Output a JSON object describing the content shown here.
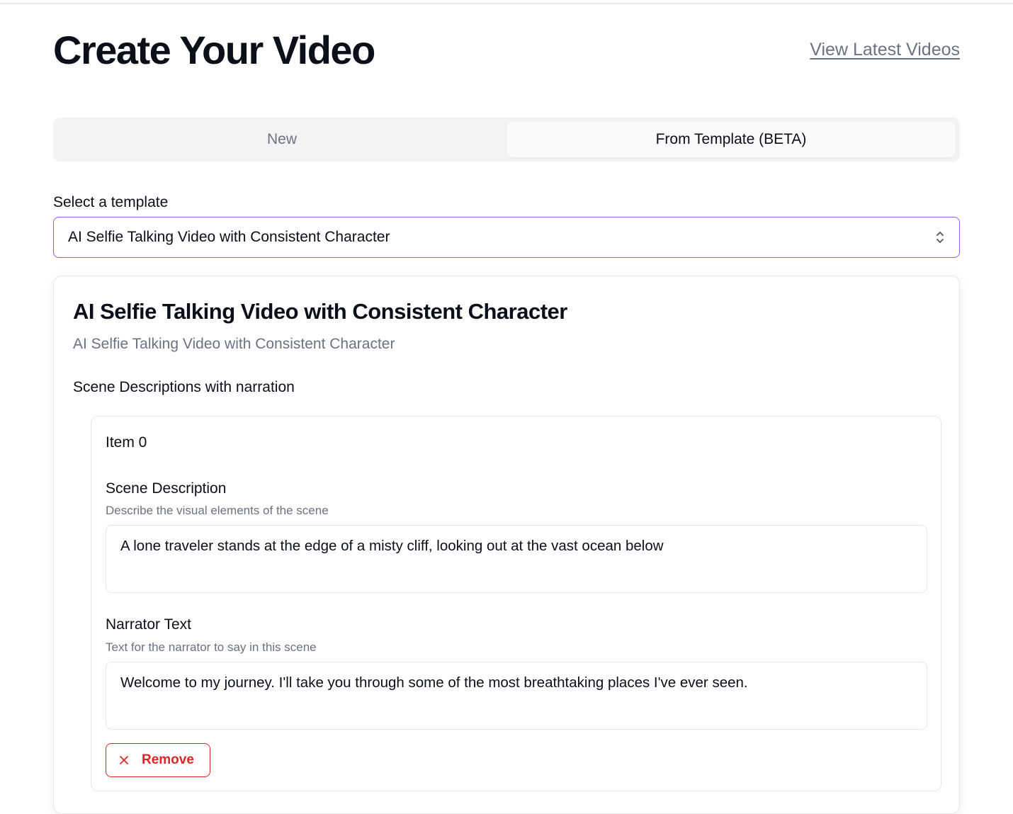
{
  "header": {
    "title": "Create Your Video",
    "latest_link": "View Latest Videos"
  },
  "tabs": [
    {
      "label": "New",
      "active": false
    },
    {
      "label": "From Template (BETA)",
      "active": true
    }
  ],
  "template_select": {
    "label": "Select a template",
    "value": "AI Selfie Talking Video with Consistent Character"
  },
  "template_card": {
    "title": "AI Selfie Talking Video with Consistent Character",
    "subtitle": "AI Selfie Talking Video with Consistent Character",
    "section_label": "Scene Descriptions with narration",
    "items": [
      {
        "title": "Item 0",
        "scene_description": {
          "label": "Scene Description",
          "hint": "Describe the visual elements of the scene",
          "value": "A lone traveler stands at the edge of a misty cliff, looking out at the vast ocean below"
        },
        "narrator_text": {
          "label": "Narrator Text",
          "hint": "Text for the narrator to say in this scene",
          "value": "Welcome to my journey. I'll take you through some of the most breathtaking places I've ever seen."
        },
        "remove_label": "Remove"
      }
    ]
  },
  "colors": {
    "accent_border": "#8b5cf6",
    "danger": "#dc2626",
    "muted_text": "#6b7280",
    "tab_track": "#f2f3f5"
  },
  "icons": {
    "select_chevron": "chevron-up-down-icon",
    "remove": "close-icon"
  }
}
